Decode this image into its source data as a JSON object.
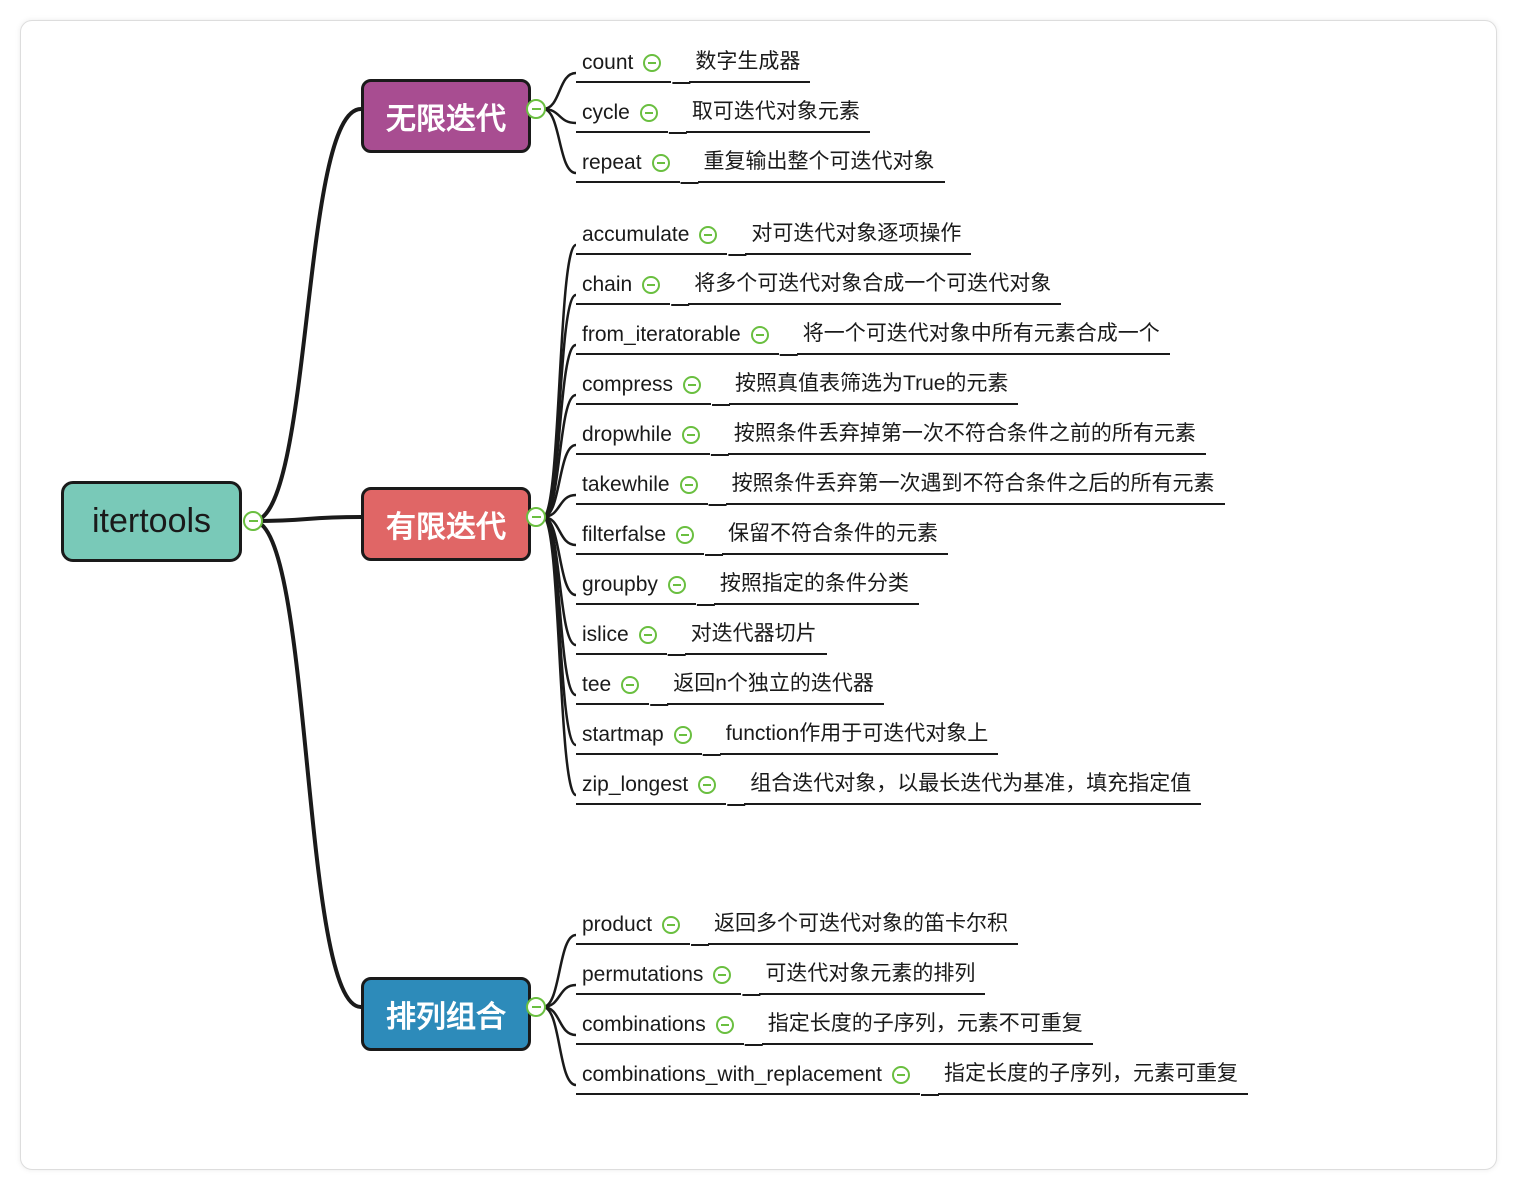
{
  "root": {
    "label": "itertools"
  },
  "branches": [
    {
      "id": "infinite",
      "label": "无限迭代",
      "color": "purple",
      "children": [
        {
          "name": "count",
          "desc": "数字生成器"
        },
        {
          "name": "cycle",
          "desc": "取可迭代对象元素"
        },
        {
          "name": "repeat",
          "desc": "重复输出整个可迭代对象"
        }
      ]
    },
    {
      "id": "finite",
      "label": "有限迭代",
      "color": "red",
      "children": [
        {
          "name": "accumulate",
          "desc": "对可迭代对象逐项操作"
        },
        {
          "name": "chain",
          "desc": "将多个可迭代对象合成一个可迭代对象"
        },
        {
          "name": "from_iteratorable",
          "desc": "将一个可迭代对象中所有元素合成一个"
        },
        {
          "name": "compress",
          "desc": "按照真值表筛选为True的元素"
        },
        {
          "name": "dropwhile",
          "desc": "按照条件丢弃掉第一次不符合条件之前的所有元素"
        },
        {
          "name": "takewhile",
          "desc": "按照条件丢弃第一次遇到不符合条件之后的所有元素"
        },
        {
          "name": "filterfalse",
          "desc": "保留不符合条件的元素"
        },
        {
          "name": "groupby",
          "desc": "按照指定的条件分类"
        },
        {
          "name": "islice",
          "desc": "对迭代器切片"
        },
        {
          "name": "tee",
          "desc": "返回n个独立的迭代器"
        },
        {
          "name": "startmap",
          "desc": "function作用于可迭代对象上"
        },
        {
          "name": "zip_longest",
          "desc": "组合迭代对象，以最长迭代为基准，填充指定值"
        }
      ]
    },
    {
      "id": "combo",
      "label": "排列组合",
      "color": "blue",
      "children": [
        {
          "name": "product",
          "desc": "返回多个可迭代对象的笛卡尔积"
        },
        {
          "name": "permutations",
          "desc": "可迭代对象元素的排列"
        },
        {
          "name": "combinations",
          "desc": "指定长度的子序列，元素不可重复"
        },
        {
          "name": "combinations_with_replacement",
          "desc": "指定长度的子序列，元素可重复"
        }
      ]
    }
  ]
}
